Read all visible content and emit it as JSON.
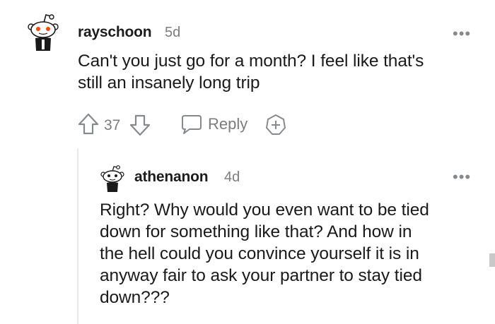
{
  "comments": [
    {
      "username": "rayschoon",
      "age": "5d",
      "text_lines": [
        "Can't you just go for a month? I feel like that's",
        "still an insanely long trip"
      ],
      "votes": "37",
      "reply_label": "Reply",
      "more_label": "•••"
    },
    {
      "username": "athenanon",
      "age": "4d",
      "text_lines": [
        "Right? Why would you even want to be tied",
        "down for something like that? And how in",
        "the hell could you convince yourself it is in",
        "anyway fair to ask your partner to stay tied",
        "down???"
      ],
      "more_label": "•••"
    }
  ],
  "colors": {
    "accent_upvote": "#ff4500",
    "meta_gray": "#7c7c7c",
    "text": "#1a1a1b"
  },
  "icons": [
    "snoo-avatar-icon",
    "upvote-icon",
    "downvote-icon",
    "comment-bubble-icon",
    "award-icon",
    "more-options-icon"
  ]
}
